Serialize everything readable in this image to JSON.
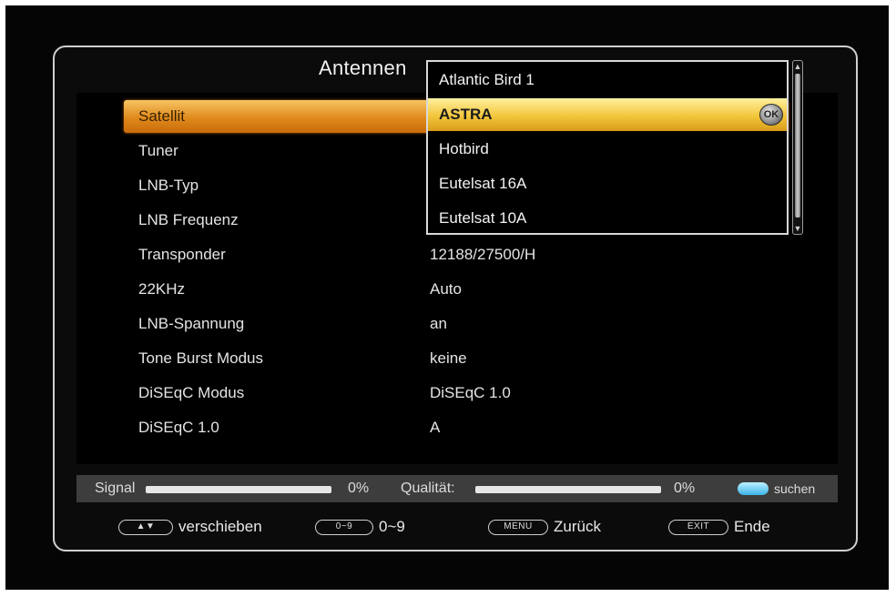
{
  "screen": {
    "title": "Antennen"
  },
  "settings": [
    {
      "label": "Satellit",
      "value": ""
    },
    {
      "label": "Tuner",
      "value": ""
    },
    {
      "label": "LNB-Typ",
      "value": ""
    },
    {
      "label": "LNB Frequenz",
      "value": ""
    },
    {
      "label": "Transponder",
      "value": "12188/27500/H"
    },
    {
      "label": "22KHz",
      "value": "Auto"
    },
    {
      "label": "LNB-Spannung",
      "value": "an"
    },
    {
      "label": "Tone Burst Modus",
      "value": "keine"
    },
    {
      "label": "DiSEqC Modus",
      "value": "DiSEqC 1.0"
    },
    {
      "label": "DiSEqC 1.0",
      "value": "A"
    }
  ],
  "dropdown": {
    "items": [
      "Atlantic Bird 1",
      "ASTRA",
      "Hotbird",
      "Eutelsat 16A",
      "Eutelsat 10A"
    ],
    "selected_index": 1,
    "ok_label": "OK"
  },
  "status": {
    "signal_label": "Signal",
    "signal_percent": "0%",
    "signal_level": 0,
    "quality_label": "Qualität:",
    "quality_percent": "0%",
    "quality_level": 0,
    "search_label": "suchen",
    "search_key_color": "#3ab4e8"
  },
  "footer": {
    "move_key": "▲▼",
    "move_label": "verschieben",
    "digits_key": "0~9",
    "digits_label": "0~9",
    "menu_key": "MENU",
    "menu_label": "Zurück",
    "exit_key": "EXIT",
    "exit_label": "Ende"
  },
  "colors": {
    "highlight_orange": "#e08a1c",
    "highlight_yellow": "#f2c53a",
    "status_bar": "#3d3d3d"
  }
}
